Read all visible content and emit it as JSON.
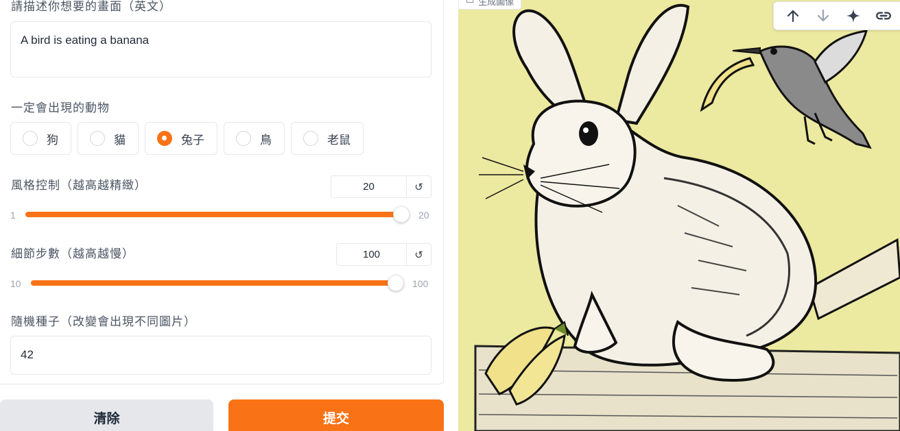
{
  "form": {
    "prompt_label": "請描述你想要的畫面（英文）",
    "prompt_value": "A bird is eating a banana",
    "animal_label": "一定會出現的動物",
    "animals": [
      {
        "label": "狗",
        "checked": false
      },
      {
        "label": "貓",
        "checked": false
      },
      {
        "label": "兔子",
        "checked": true
      },
      {
        "label": "鳥",
        "checked": false
      },
      {
        "label": "老鼠",
        "checked": false
      }
    ],
    "style": {
      "label": "風格控制（越高越精緻）",
      "value": "20",
      "min": "1",
      "max": "20",
      "reset_icon": "↺"
    },
    "steps": {
      "label": "細節步數（越高越慢）",
      "value": "100",
      "min": "10",
      "max": "100",
      "reset_icon": "↺"
    },
    "seed": {
      "label": "隨機種子（改變會出現不同圖片）",
      "value": "42"
    }
  },
  "buttons": {
    "clear": "清除",
    "submit": "提交"
  },
  "output": {
    "label": "生成圖像",
    "toolbar": [
      "arrow-up-icon",
      "arrow-down-icon",
      "sparkle-icon",
      "link-icon"
    ]
  },
  "colors": {
    "accent": "#f97316",
    "image_bg": "#ece9a0"
  }
}
